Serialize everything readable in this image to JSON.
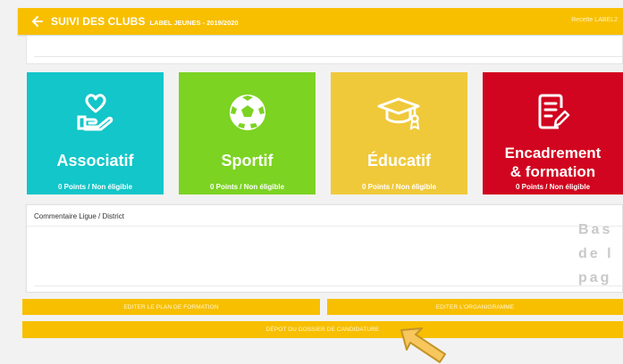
{
  "header": {
    "title": "SUIVI DES CLUBS",
    "subtitle": "LABEL JEUNES - 2019/2020",
    "user": "Recette LABEL2"
  },
  "tiles": [
    {
      "name": "Associatif",
      "points": "0 Points / Non éligible",
      "color": "#12c6c9",
      "icon": "heart-hand-icon"
    },
    {
      "name": "Sportif",
      "points": "0 Points / Non éligible",
      "color": "#7cd322",
      "icon": "soccer-ball-icon"
    },
    {
      "name": "Éducatif",
      "points": "0 Points / Non éligible",
      "color": "#f0c93a",
      "icon": "graduation-cap-icon"
    },
    {
      "name_line1": "Encadrement",
      "name_line2": "& formation",
      "points": "0 Points / Non éligible",
      "color": "#d1051f",
      "icon": "document-edit-icon"
    }
  ],
  "comment": {
    "label": "Commentaire Ligue / District"
  },
  "side_text": [
    "Bas",
    "de l",
    "pag"
  ],
  "buttons": {
    "formation_plan": "EDITER LE PLAN DE FORMATION",
    "org_chart": "EDITER L'ORGANIGRAMME",
    "submit_application": "DÉPOT DU DOSSIER DE CANDIDATURE"
  },
  "colors": {
    "accent": "#f8bf00",
    "associatif": "#12c6c9",
    "sportif": "#7cd322",
    "educatif": "#f0c93a",
    "encadrement": "#d1051f"
  }
}
